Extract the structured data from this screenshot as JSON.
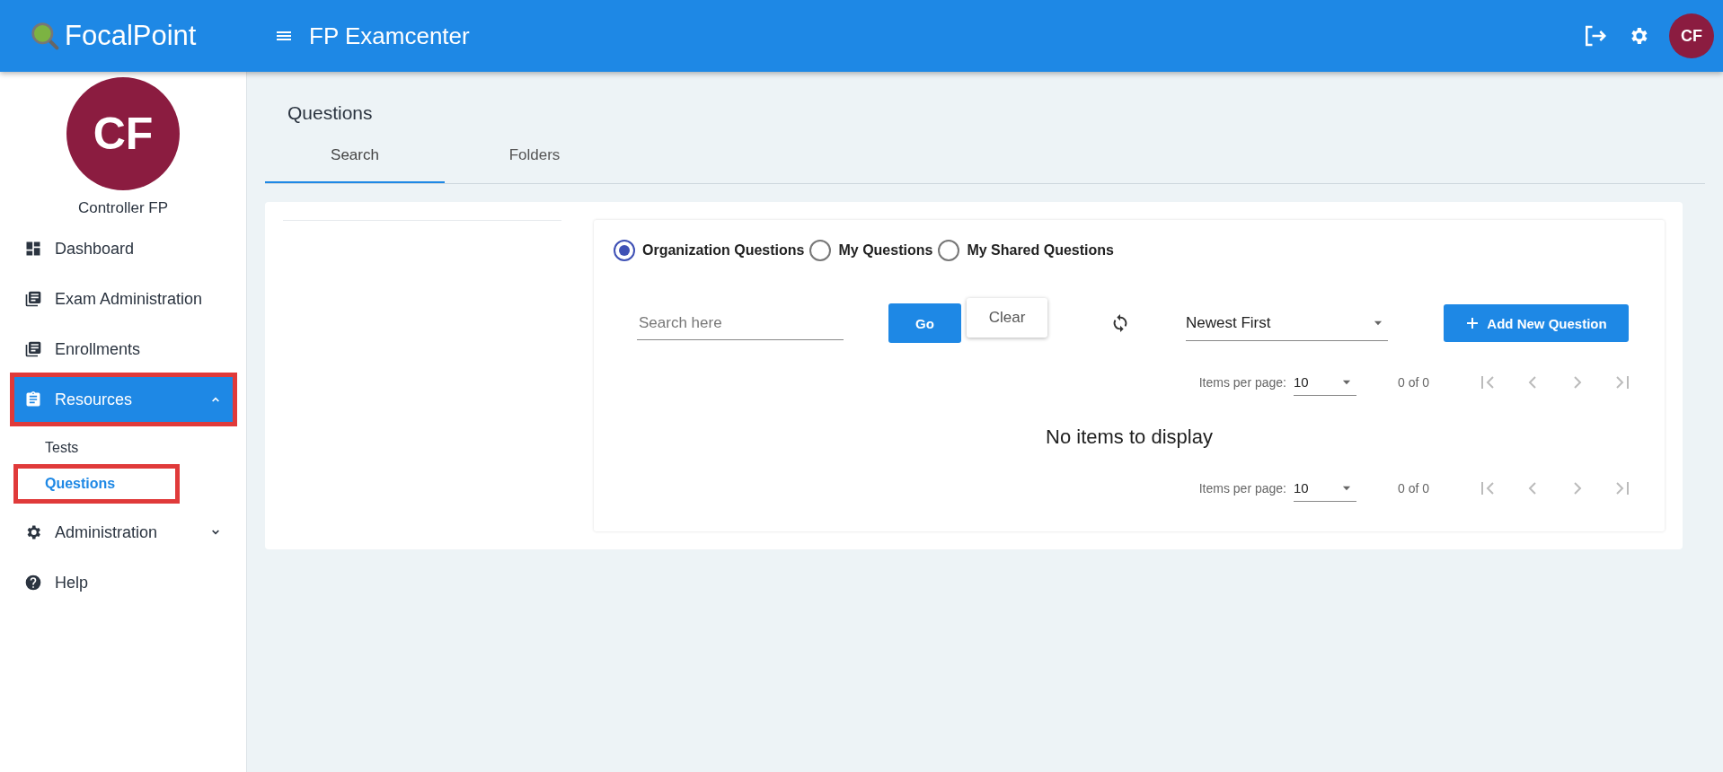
{
  "header": {
    "brand": "FocalPoint",
    "app_title": "FP Examcenter",
    "avatar_initials": "CF"
  },
  "sidebar": {
    "avatar_initials": "CF",
    "user_name": "Controller FP",
    "items": [
      {
        "label": "Dashboard",
        "selected": false,
        "highlighted": false
      },
      {
        "label": "Exam Administration",
        "selected": false,
        "highlighted": false
      },
      {
        "label": "Enrollments",
        "selected": false,
        "highlighted": false
      },
      {
        "label": "Resources",
        "selected": true,
        "highlighted": true,
        "expanded": true,
        "children": [
          {
            "label": "Tests",
            "selected": false,
            "highlighted": false
          },
          {
            "label": "Questions",
            "selected": true,
            "highlighted": true
          }
        ]
      },
      {
        "label": "Administration",
        "selected": false,
        "highlighted": false,
        "expanded": false
      },
      {
        "label": "Help",
        "selected": false,
        "highlighted": false
      }
    ]
  },
  "page": {
    "title": "Questions",
    "tabs": [
      {
        "label": "Search",
        "selected": true
      },
      {
        "label": "Folders",
        "selected": false
      }
    ]
  },
  "filters": [
    {
      "label": "Organization Questions",
      "selected": true
    },
    {
      "label": "My Questions",
      "selected": false
    },
    {
      "label": "My Shared Questions",
      "selected": false
    }
  ],
  "search": {
    "placeholder": "Search here"
  },
  "go_button": "Go",
  "clear_button": "Clear",
  "sort": {
    "value": "Newest First"
  },
  "add_button": "Add New Question",
  "paginators": [
    {
      "label": "Items per page:",
      "page_size": "10",
      "range": "0 of 0"
    },
    {
      "label": "Items per page:",
      "page_size": "10",
      "range": "0 of 0"
    }
  ],
  "empty_message": "No items to display"
}
